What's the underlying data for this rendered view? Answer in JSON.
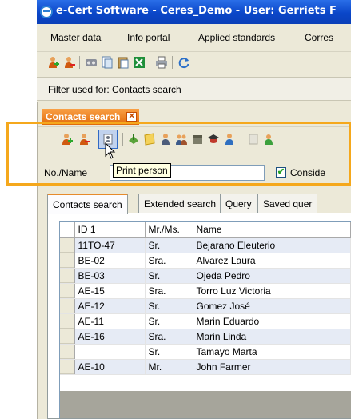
{
  "window": {
    "title": "e-Cert Software - Ceres_Demo - User: Gerriets F",
    "icon": "e-cert-logo-icon"
  },
  "menu": {
    "items": [
      "Master data",
      "Info portal",
      "Applied standards",
      "Corres"
    ]
  },
  "main_toolbar": {
    "icons": [
      "add-person-icon",
      "delete-person-icon",
      "tape-icon",
      "copy-document-icon",
      "paste-document-icon",
      "excel-icon",
      "print-icon",
      "refresh-icon"
    ]
  },
  "filter": {
    "text": "Filter used for: Contacts search"
  },
  "panel": {
    "tab_label": "Contacts search",
    "toolbar_icons": [
      "add-person-icon",
      "delete-person-icon",
      "print-person-icon",
      "export-icon",
      "note-icon",
      "person-icon",
      "group-icon",
      "archive-icon",
      "graduation-icon",
      "user-icon",
      "disabled-doc-icon",
      "search-person-icon"
    ],
    "tooltip": "Print person",
    "search": {
      "label": "No./Name",
      "value": "",
      "checkbox_label": "Conside",
      "checked": true
    },
    "tabs": [
      "Contacts search",
      "Extended search",
      "Query",
      "Saved quer"
    ],
    "active_tab": 0
  },
  "table": {
    "columns": [
      "ID 1",
      "Mr./Ms.",
      "Name"
    ],
    "rows": [
      {
        "id": "11TO-47",
        "title": "Sr.",
        "name": "Bejarano Eleuterio"
      },
      {
        "id": "BE-02",
        "title": "Sra.",
        "name": "Alvarez Laura"
      },
      {
        "id": "BE-03",
        "title": "Sr.",
        "name": "Ojeda Pedro"
      },
      {
        "id": "AE-15",
        "title": "Sra.",
        "name": "Torro Luz Victoria"
      },
      {
        "id": "AE-12",
        "title": "Sr.",
        "name": "Gomez José"
      },
      {
        "id": "AE-11",
        "title": "Sr.",
        "name": "Marin Eduardo"
      },
      {
        "id": "AE-16",
        "title": "Sra.",
        "name": "Marin Linda"
      },
      {
        "id": "",
        "title": "Sr.",
        "name": "Tamayo Marta"
      },
      {
        "id": "AE-10",
        "title": "Mr.",
        "name": "John Farmer"
      }
    ]
  },
  "colors": {
    "title_bar": "#0a46c8",
    "panel_tab": "#e26a0a",
    "highlight": "#f5a81c",
    "row_alt": "#e6ebf5"
  }
}
